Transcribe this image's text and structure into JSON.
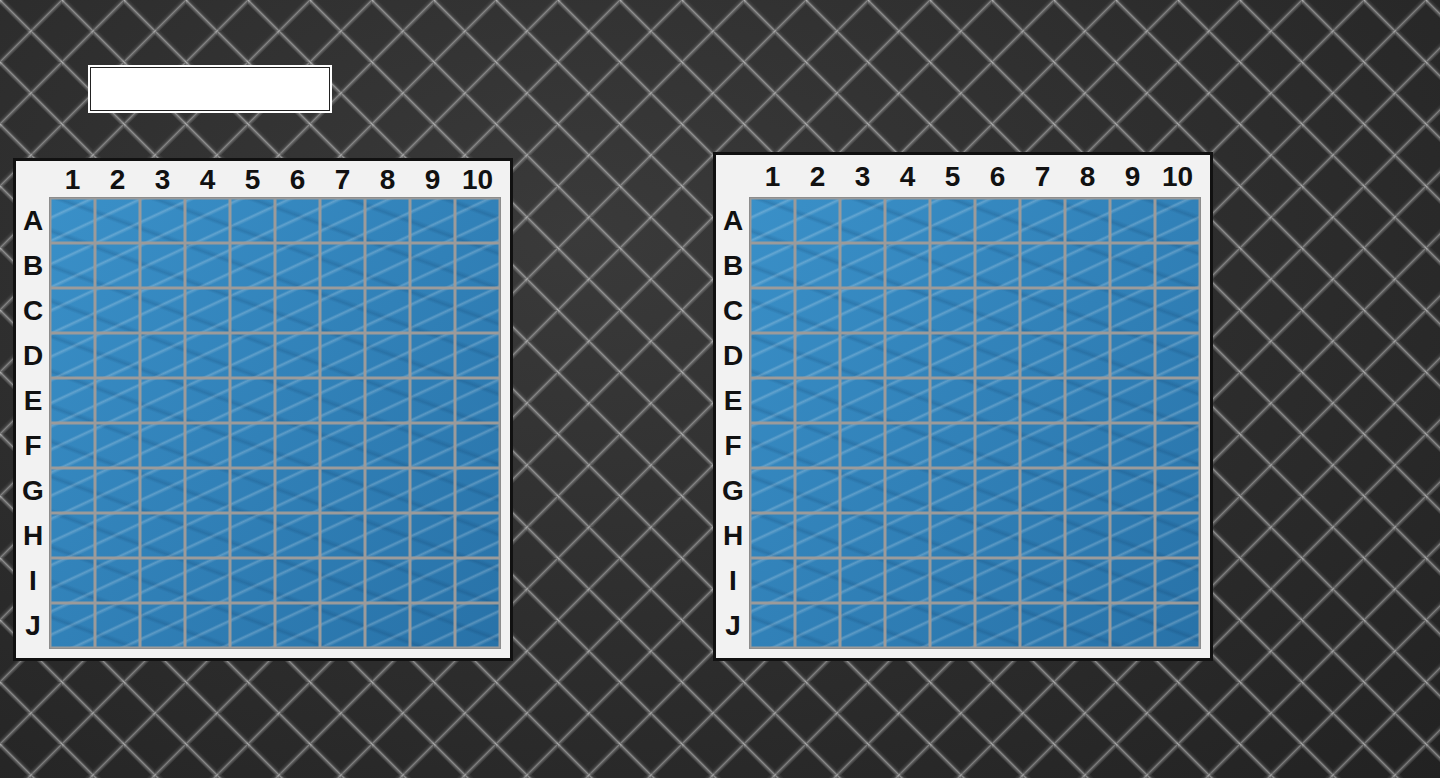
{
  "name_field": {
    "value": ""
  },
  "boards": [
    {
      "name": "player-board",
      "columns": [
        "1",
        "2",
        "3",
        "4",
        "5",
        "6",
        "7",
        "8",
        "9",
        "10"
      ],
      "rows": [
        "A",
        "B",
        "C",
        "D",
        "E",
        "F",
        "G",
        "H",
        "I",
        "J"
      ]
    },
    {
      "name": "opponent-board",
      "columns": [
        "1",
        "2",
        "3",
        "4",
        "5",
        "6",
        "7",
        "8",
        "9",
        "10"
      ],
      "rows": [
        "A",
        "B",
        "C",
        "D",
        "E",
        "F",
        "G",
        "H",
        "I",
        "J"
      ]
    }
  ]
}
